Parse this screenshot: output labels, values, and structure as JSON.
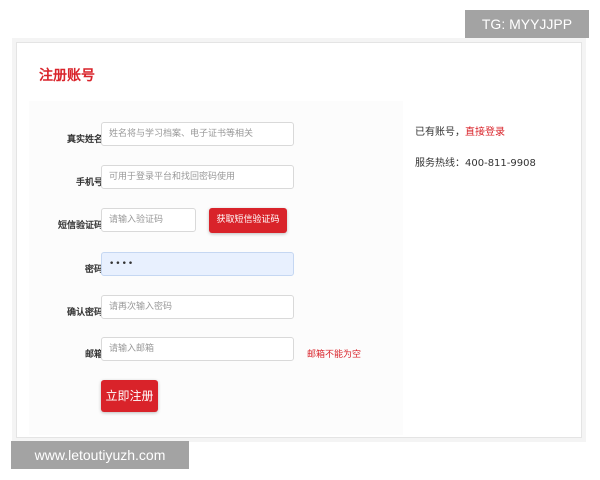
{
  "colors": {
    "brand_red": "#d9232a",
    "error_red": "#d9232a",
    "watermark_bg": "#a3a3a3"
  },
  "page": {
    "title": "注册账号"
  },
  "form": {
    "name": {
      "label": "真实姓名",
      "placeholder": "姓名将与学习档案、电子证书等相关",
      "value": ""
    },
    "phone": {
      "label": "手机号",
      "placeholder": "可用于登录平台和找回密码使用",
      "value": ""
    },
    "sms": {
      "label": "短信验证码",
      "placeholder": "请输入验证码",
      "value": "",
      "get_code_label": "获取短信验证码"
    },
    "password": {
      "label": "密码",
      "value": "••••"
    },
    "confirm": {
      "label": "确认密码",
      "placeholder": "请再次输入密码",
      "value": ""
    },
    "email": {
      "label": "邮箱",
      "placeholder": "请输入邮箱",
      "value": "",
      "error": "邮箱不能为空"
    },
    "submit_label": "立即注册"
  },
  "side": {
    "have_account": "已有账号，",
    "login_link": "直接登录",
    "hotline": "服务热线：400-811-9908"
  },
  "watermarks": {
    "top": "TG: MYYJJPP",
    "bottom": "www.letoutiyuzh.com"
  }
}
